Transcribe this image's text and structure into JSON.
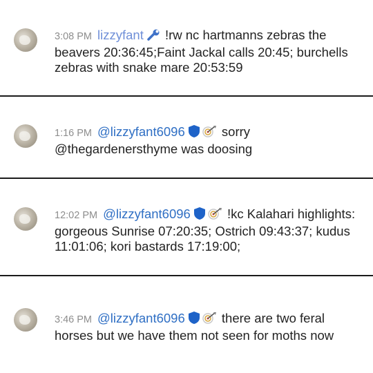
{
  "messages": [
    {
      "time": "3:08 PM",
      "username": "lizzyfant",
      "badges": [
        "wrench-icon"
      ],
      "text": "!rw nc hartmanns zebras the beavers 20:36:45;Faint Jackal calls 20:45; burchells zebras with snake mare 20:53:59"
    },
    {
      "time": "1:16 PM",
      "username": "@lizzyfant6096",
      "badges": [
        "shield-icon",
        "target-arrow-icon"
      ],
      "text": "sorry @thegardenersthyme was doosing"
    },
    {
      "time": "12:02 PM",
      "username": "@lizzyfant6096",
      "badges": [
        "shield-icon",
        "target-arrow-icon"
      ],
      "text": "!kc Kalahari highlights: gorgeous Sunrise 07:20:35; Ostrich 09:43:37; kudus 11:01:06; kori bastards 17:19:00;"
    },
    {
      "time": "3:46 PM",
      "username": "@lizzyfant6096",
      "badges": [
        "shield-icon",
        "target-arrow-icon"
      ],
      "text": "there are two feral horses but we have them not seen for moths now"
    }
  ],
  "colors": {
    "username_first": "#6f8fd8",
    "username": "#2f6fc4",
    "timestamp": "#8d8d8d",
    "shield": "#1e63c8",
    "separator": "#1a1a1a"
  }
}
